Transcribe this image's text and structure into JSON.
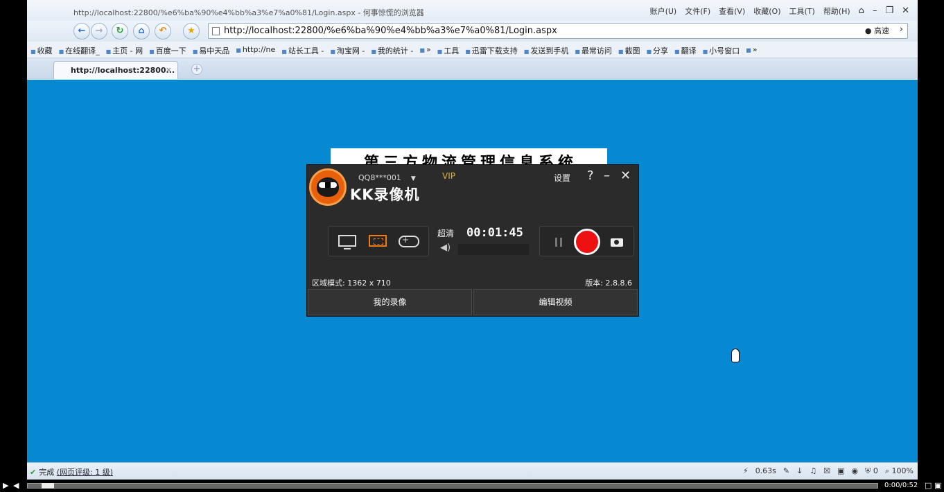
{
  "browser": {
    "window_title": "http://localhost:22800/%e6%ba%90%e4%bb%a3%e7%a0%81/Login.aspx - 何事惊慌的浏览器",
    "menu": [
      "账户(U)",
      "文件(F)",
      "查看(V)",
      "收藏(O)",
      "工具(T)",
      "帮助(H)"
    ],
    "url": "http://localhost:22800/%e6%ba%90%e4%bb%a3%e7%a0%81/Login.aspx",
    "speed_label": "高速",
    "favorites": [
      "收藏",
      "在线翻译_",
      "主页 - 网",
      "百度一下",
      "易中天品",
      "http://ne",
      "站长工具 -",
      "淘宝网 -",
      "我的统计 -",
      "»",
      "工具",
      "迅雷下载支持",
      "发送到手机",
      "最常访问",
      "截图",
      "分享",
      "翻译",
      "小号窗口",
      "»"
    ],
    "tab_title": "http://localhost:22800...",
    "status": {
      "done": "完成",
      "rating": "(网页评级: 1 级)",
      "time": "0.63s",
      "count": "0",
      "zoom": "100%"
    }
  },
  "page": {
    "banner_text": "第三方物流管理信息系统"
  },
  "recorder": {
    "user": "QQ8***001",
    "vip": "VIP",
    "app_name": "KK录像机",
    "settings": "设置",
    "help": "?",
    "minimize": "–",
    "close": "✕",
    "quality": "超清",
    "timer": "00:01:45",
    "mode_text": "区域模式: 1362 x 710",
    "version_text": "版本: 2.8.8.6",
    "my_videos": "我的录像",
    "edit_video": "编辑视频",
    "brand_color": "#e85f0c",
    "record_color": "#ee1111"
  },
  "player": {
    "time": "0:00/0:52"
  }
}
